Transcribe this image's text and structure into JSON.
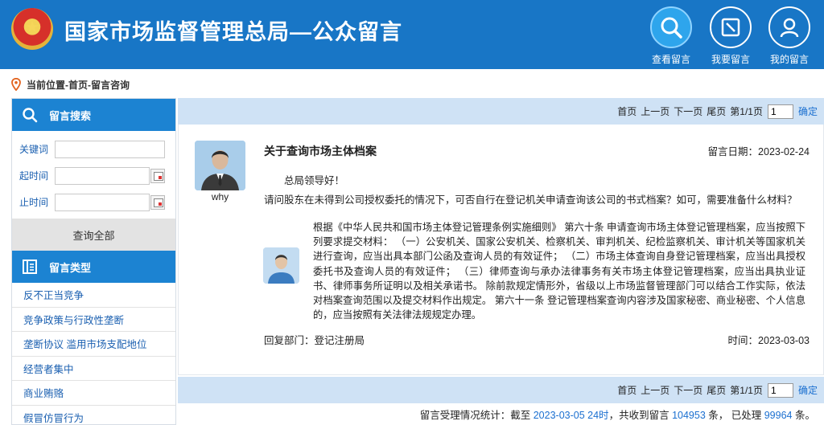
{
  "header": {
    "title": "国家市场监督管理总局—公众留言",
    "nav": [
      {
        "label": "查看留言",
        "icon": "search-icon"
      },
      {
        "label": "我要留言",
        "icon": "edit-icon"
      },
      {
        "label": "我的留言",
        "icon": "user-icon"
      }
    ]
  },
  "breadcrumb": "当前位置-首页-留言咨询",
  "sidebar": {
    "search_title": "留言搜索",
    "keyword_label": "关键词",
    "keyword_value": "",
    "start_label": "起时间",
    "start_value": "",
    "end_label": "止时间",
    "end_value": "",
    "query_all": "查询全部",
    "types_title": "留言类型",
    "types": [
      "反不正当竞争",
      "竞争政策与行政性垄断",
      "垄断协议 滥用市场支配地位",
      "经营者集中",
      "商业贿赂",
      "假冒仿冒行为"
    ]
  },
  "pager": {
    "first": "首页",
    "prev": "上一页",
    "next": "下一页",
    "last": "尾页",
    "page_info": "第1/1页",
    "page_value": "1",
    "confirm": "确定"
  },
  "message": {
    "user": "why",
    "title": "关于查询市场主体档案",
    "date_label": "留言日期：",
    "date": "2023-02-24",
    "greeting": "总局领导好！",
    "question": "请问股东在未得到公司授权委托的情况下，可否自行在登记机关申请查询该公司的书式档案？如可，需要准备什么材料？",
    "reply": "根据《中华人民共和国市场主体登记管理条例实施细则》 第六十条 申请查询市场主体登记管理档案，应当按照下列要求提交材料： （一）公安机关、国家公安机关、检察机关、审判机关、纪检监察机关、审计机关等国家机关进行查询，应当出具本部门公函及查询人员的有效证件； （二）市场主体查询自身登记管理档案，应当出具授权委托书及查询人员的有效证件； （三）律师查询与承办法律事务有关市场主体登记管理档案，应当出具执业证书、律师事务所证明以及相关承诺书。 除前款规定情形外，省级以上市场监督管理部门可以结合工作实际，依法对档案查询范围以及提交材料作出规定。 第六十一条 登记管理档案查询内容涉及国家秘密、商业秘密、个人信息的，应当按照有关法律法规规定办理。",
    "reply_dept_label": "回复部门：",
    "reply_dept": "登记注册局",
    "reply_time_label": "时间：",
    "reply_time": "2023-03-03"
  },
  "stats": {
    "prefix": "留言受理情况统计：截至",
    "date": "2023-03-05 24时",
    "mid1": "，共收到留言",
    "total": "104953",
    "mid2": "条， 已处理",
    "processed": "99964",
    "suffix": "条。"
  },
  "colors": {
    "header_bg": "#1876c6",
    "sidebar_head": "#1c83d2",
    "pager_bg": "#cfe2f5",
    "link": "#1a6fd0"
  }
}
